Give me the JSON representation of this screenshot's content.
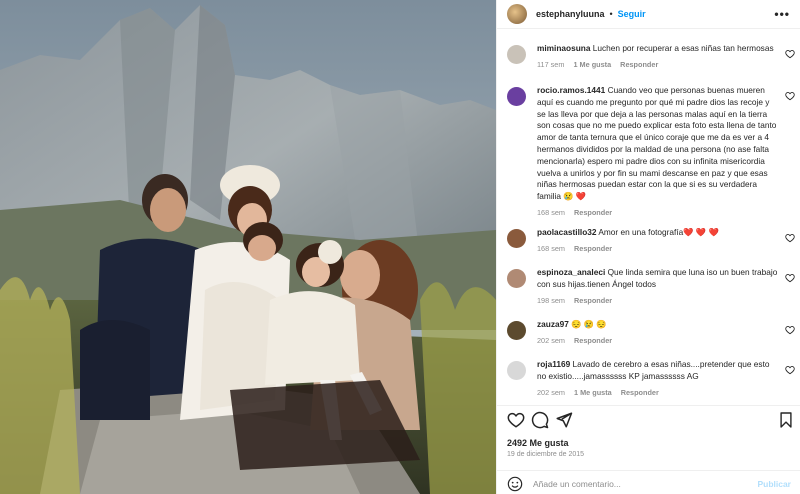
{
  "post": {
    "username": "estephanyluuna",
    "follow_label": "Seguir",
    "more_label": "•••",
    "likes": "2492 Me gusta",
    "date": "19 de diciembre de 2015"
  },
  "comments": [
    {
      "user": "miminaosuna",
      "text": "Luchen por recuperar a esas niñas tan hermosas",
      "age": "117 sem",
      "likes": "1 Me gusta",
      "reply": "Responder",
      "avatar_color": "#c9c2b8"
    },
    {
      "user": "rocio.ramos.1441",
      "text": "Cuando veo que personas buenas mueren aquí es cuando me pregunto por qué mi padre dios las recoje y se las lleva por que deja a las personas malas aquí en la tierra son cosas que no me puedo explicar esta foto esta llena de tanto amor de tanta ternura que el único coraje que me da es ver a 4 hermanos divididos por la maldad de una persona (no ase falta mencionarla) espero mi padre dios con su infinita misericordia vuelva a unirlos y por fin su mami descanse en paz y que esas niñas hermosas puedan estar con la que si es su verdadera familia 😢 ❤️",
      "age": "168 sem",
      "likes": "",
      "reply": "Responder",
      "avatar_color": "#6a3fa0"
    },
    {
      "user": "paolacastillo32",
      "text": "Amor en una fotografía❤️ ❤️ ❤️",
      "age": "168 sem",
      "likes": "",
      "reply": "Responder",
      "avatar_color": "#8a5a3c"
    },
    {
      "user": "espinoza_analeci",
      "text": "Que linda semira que luna iso un buen trabajo con sus hijas.tienen Ángel todos",
      "age": "198 sem",
      "likes": "",
      "reply": "Responder",
      "avatar_color": "#b08a74"
    },
    {
      "user": "zauza97",
      "text": "😔 😢 😔",
      "age": "202 sem",
      "likes": "",
      "reply": "Responder",
      "avatar_color": "#5c4a2e"
    },
    {
      "user": "roja1169",
      "text": "Lavado de cerebro a esas niñas....pretender que esto no existio.....jamassssss KP jamassssss AG",
      "age": "202 sem",
      "likes": "1 Me gusta",
      "reply": "Responder",
      "avatar_color": "#d8d8d8"
    }
  ],
  "comment_box": {
    "placeholder": "Añade un comentario...",
    "post_label": "Publicar"
  },
  "icons": {
    "like": "heart-icon",
    "comment": "comment-icon",
    "share": "share-icon",
    "save": "bookmark-icon",
    "emoji": "emoji-icon"
  },
  "colors": {
    "follow": "#0095f6",
    "muted": "#8e8e8e",
    "publish_disabled": "#b2dffc"
  }
}
